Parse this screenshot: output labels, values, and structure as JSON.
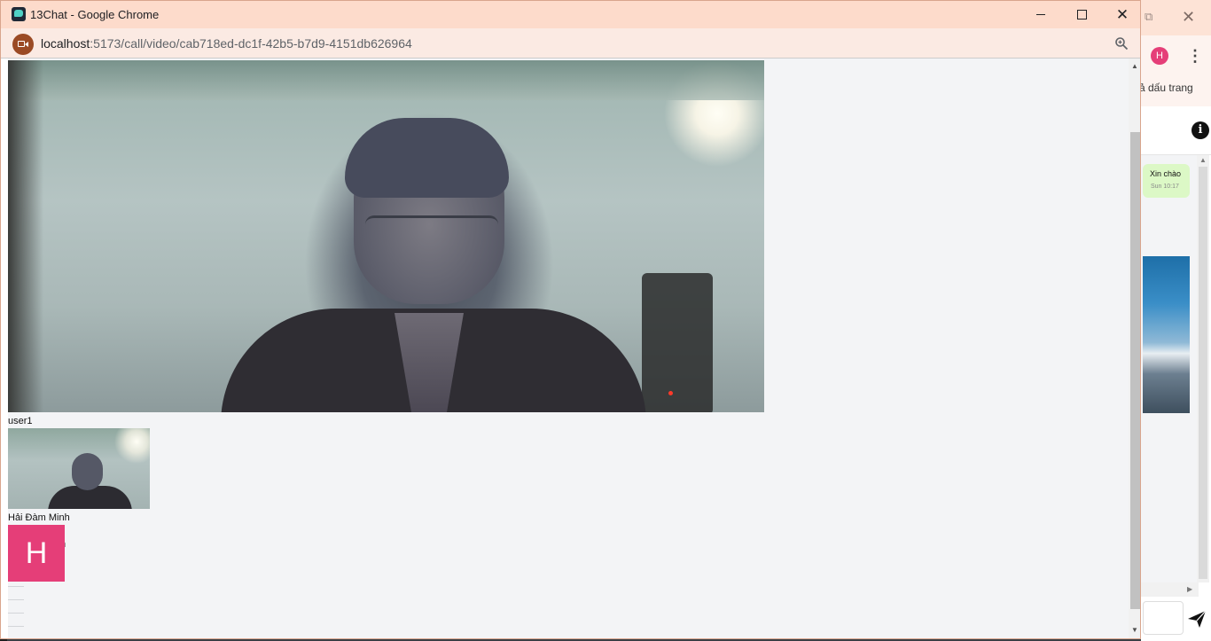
{
  "popup": {
    "window_title": "13Chat - Google Chrome",
    "window_controls": {
      "minimize": "—",
      "maximize": "☐",
      "close": "✕"
    },
    "url_host": "localhost",
    "url_path": ":5173/call/video/cab718ed-dc1f-42b5-b7d9-4151db626964"
  },
  "call": {
    "main_video_label": "user1",
    "thumbnail_label": "Hải Đàm Minh",
    "ghost_label_1": "h",
    "ghost_label_2": "u",
    "avatar_initial": "H"
  },
  "background_window": {
    "profile_initial": "H",
    "bookmarks_text": "ả dấu trang",
    "message_text": "Xin chào",
    "message_time": "Sun 10:17"
  },
  "colors": {
    "titlebar": "#fddbcb",
    "avatar_pink": "#e53e78",
    "content_bg": "#f3f4f6",
    "message_bubble": "#dcf8c6"
  },
  "icons": [
    "app-icon",
    "video-camera-icon",
    "zoom-icon",
    "kebab-menu-icon",
    "info-icon",
    "send-icon",
    "restore-icon",
    "close-icon"
  ]
}
